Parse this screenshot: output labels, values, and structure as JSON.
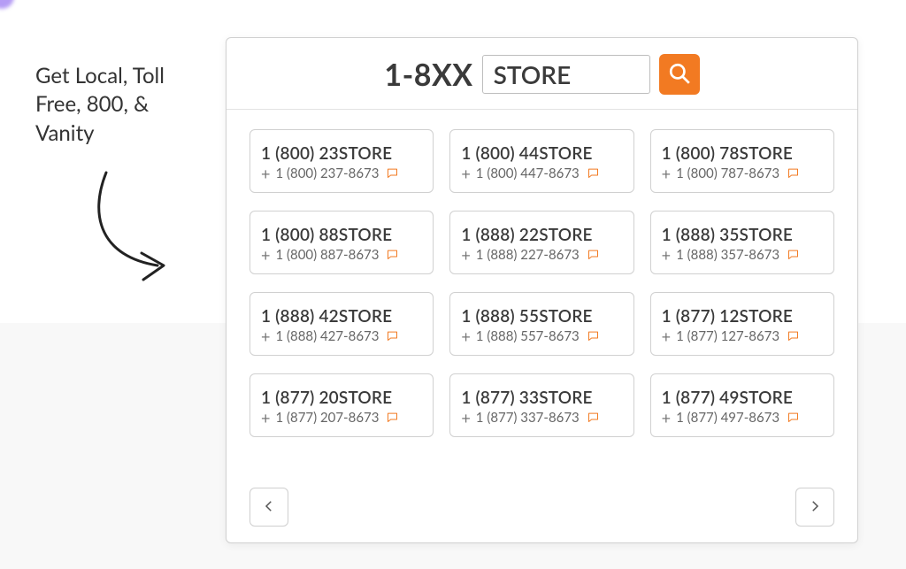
{
  "callout": "Get Local, Toll Free, 800, & Vanity",
  "search": {
    "prefix": "1-8XX",
    "term": "STORE",
    "placeholder": "STORE"
  },
  "results": [
    {
      "vanity": "1 (800) 23STORE",
      "numeric": "1 (800) 237-8673"
    },
    {
      "vanity": "1 (800) 44STORE",
      "numeric": "1 (800) 447-8673"
    },
    {
      "vanity": "1 (800) 78STORE",
      "numeric": "1 (800) 787-8673"
    },
    {
      "vanity": "1 (800) 88STORE",
      "numeric": "1 (800) 887-8673"
    },
    {
      "vanity": "1 (888) 22STORE",
      "numeric": "1 (888) 227-8673"
    },
    {
      "vanity": "1 (888) 35STORE",
      "numeric": "1 (888) 357-8673"
    },
    {
      "vanity": "1 (888) 42STORE",
      "numeric": "1 (888) 427-8673"
    },
    {
      "vanity": "1 (888) 55STORE",
      "numeric": "1 (888) 557-8673"
    },
    {
      "vanity": "1 (877) 12STORE",
      "numeric": "1 (877) 127-8673"
    },
    {
      "vanity": "1 (877) 20STORE",
      "numeric": "1 (877) 207-8673"
    },
    {
      "vanity": "1 (877) 33STORE",
      "numeric": "1 (877) 337-8673"
    },
    {
      "vanity": "1 (877) 49STORE",
      "numeric": "1 (877) 497-8673"
    }
  ],
  "icons": {
    "plus": "+"
  }
}
